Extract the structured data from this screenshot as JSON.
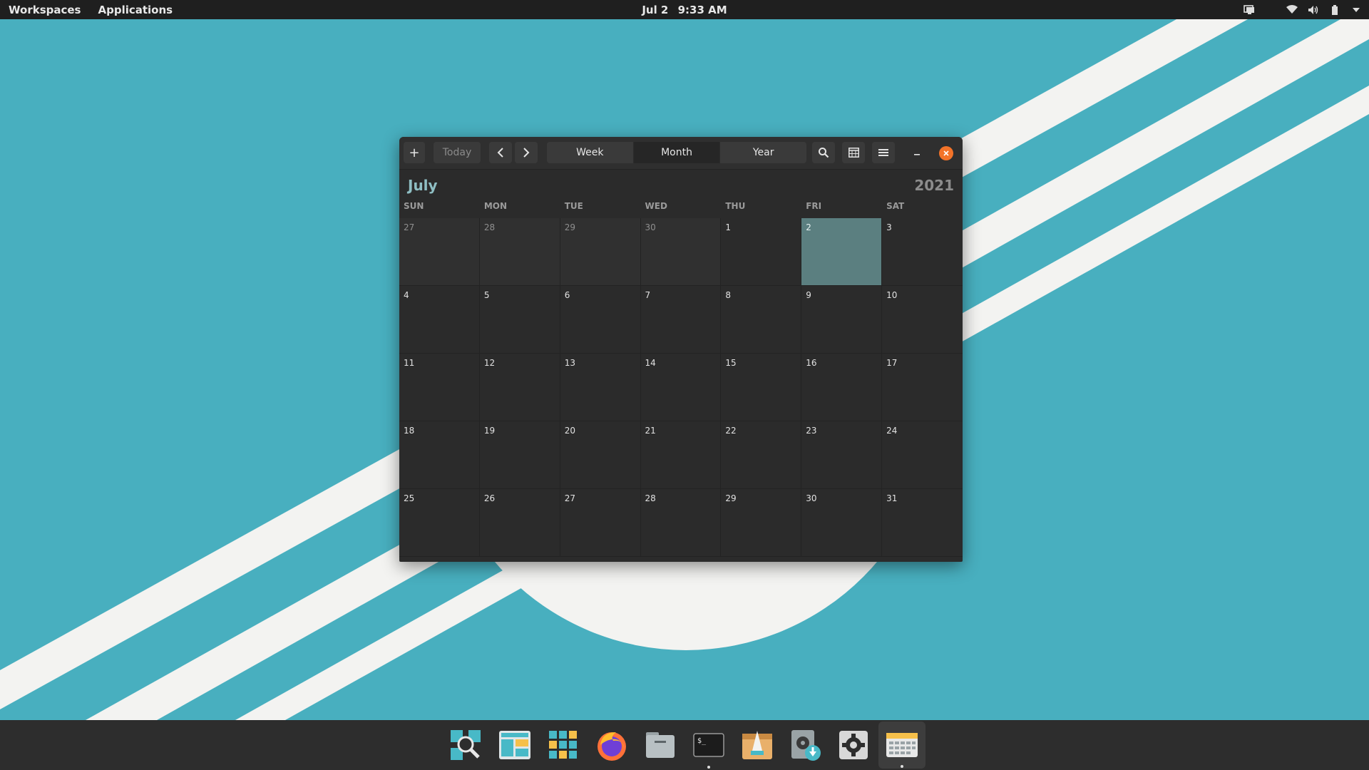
{
  "top_panel": {
    "workspaces_label": "Workspaces",
    "applications_label": "Applications",
    "date": "Jul 2",
    "time": "9:33 AM",
    "tray_icons": [
      "display-icon",
      "wifi-icon",
      "volume-icon",
      "battery-icon",
      "chevron-down-icon"
    ]
  },
  "window": {
    "add_label": "+",
    "today_label": "Today",
    "views": [
      {
        "label": "Week",
        "active": false
      },
      {
        "label": "Month",
        "active": true
      },
      {
        "label": "Year",
        "active": false
      }
    ],
    "month": "July",
    "year": "2021",
    "weekdays": [
      "SUN",
      "MON",
      "TUE",
      "WED",
      "THU",
      "FRI",
      "SAT"
    ],
    "days": [
      {
        "n": "27",
        "other": true
      },
      {
        "n": "28",
        "other": true
      },
      {
        "n": "29",
        "other": true
      },
      {
        "n": "30",
        "other": true
      },
      {
        "n": "1"
      },
      {
        "n": "2",
        "today": true
      },
      {
        "n": "3"
      },
      {
        "n": "4"
      },
      {
        "n": "5"
      },
      {
        "n": "6"
      },
      {
        "n": "7"
      },
      {
        "n": "8"
      },
      {
        "n": "9"
      },
      {
        "n": "10"
      },
      {
        "n": "11"
      },
      {
        "n": "12"
      },
      {
        "n": "13"
      },
      {
        "n": "14"
      },
      {
        "n": "15"
      },
      {
        "n": "16"
      },
      {
        "n": "17"
      },
      {
        "n": "18"
      },
      {
        "n": "19"
      },
      {
        "n": "20"
      },
      {
        "n": "21"
      },
      {
        "n": "22"
      },
      {
        "n": "23"
      },
      {
        "n": "24"
      },
      {
        "n": "25"
      },
      {
        "n": "26"
      },
      {
        "n": "27"
      },
      {
        "n": "28"
      },
      {
        "n": "29"
      },
      {
        "n": "30"
      },
      {
        "n": "31"
      }
    ]
  },
  "dock": {
    "apps": [
      {
        "name": "search-app-icon",
        "running": false
      },
      {
        "name": "multitasking-icon",
        "running": false
      },
      {
        "name": "app-grid-icon",
        "running": false
      },
      {
        "name": "firefox-icon",
        "running": false
      },
      {
        "name": "files-icon",
        "running": false
      },
      {
        "name": "terminal-icon",
        "running": true
      },
      {
        "name": "pop-shop-icon",
        "running": false
      },
      {
        "name": "installer-icon",
        "running": false
      },
      {
        "name": "settings-icon",
        "running": false
      },
      {
        "name": "calendar-icon",
        "running": true
      }
    ]
  },
  "colors": {
    "wallpaper": "#48afbf",
    "today_highlight": "#5b7f80",
    "accent_close": "#f37329",
    "month_name": "#8fbfc4"
  }
}
